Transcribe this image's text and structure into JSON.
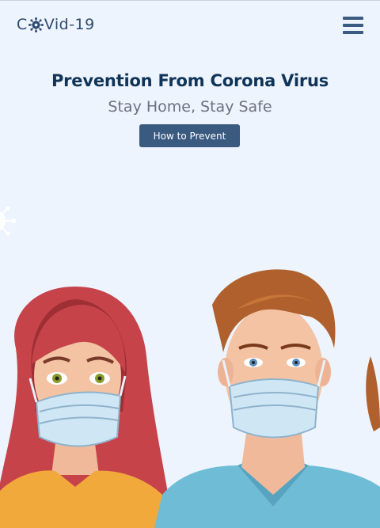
{
  "brand": {
    "text_before": "C",
    "text_after": "Vid-19"
  },
  "nav": {
    "menu_icon": "hamburger-menu-icon"
  },
  "hero": {
    "title": "Prevention From Corona Virus",
    "subtitle": "Stay Home, Stay Safe",
    "button_label": "How to Prevent"
  },
  "illustration": {
    "icon": "people-wearing-masks-illustration"
  },
  "decoration": {
    "icon": "virus-icon"
  },
  "colors": {
    "background": "#edf4fd",
    "brand_text": "#2f4a6e",
    "title": "#0f3457",
    "subtitle": "#6b7280",
    "button_bg": "#3b5a7f",
    "button_text": "#ffffff"
  }
}
